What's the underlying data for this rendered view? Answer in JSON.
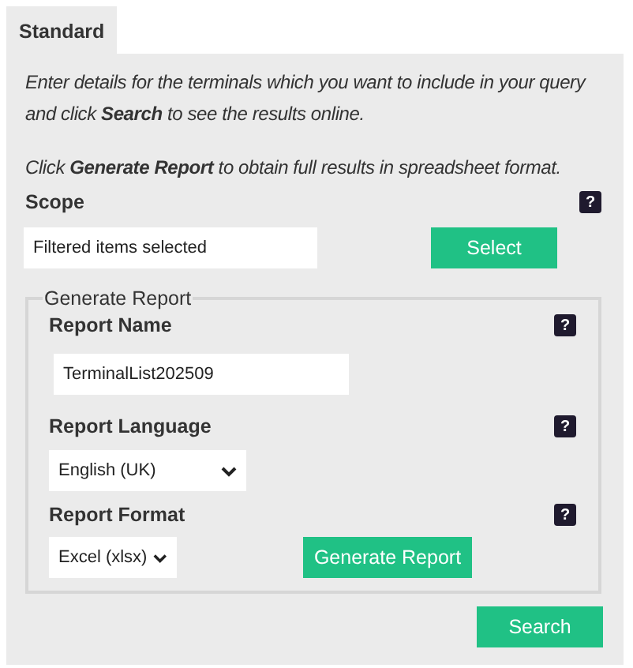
{
  "tabs": [
    {
      "label": "Standard",
      "selected": true
    }
  ],
  "intro": [
    "Enter details for the terminals which you want to include in your query and click **Search** to see the results online.",
    "Click **Generate Report** to obtain full results in spreadsheet format."
  ],
  "scope": {
    "label": "Scope",
    "help": "?",
    "value": "Filtered items selected",
    "button": "Select"
  },
  "generate_report": {
    "legend": "Generate Report",
    "report_name": {
      "label": "Report Name",
      "help": "?",
      "value": "TerminalList202509"
    },
    "report_language": {
      "label": "Report Language",
      "help": "?",
      "value": "English (UK)"
    },
    "report_format": {
      "label": "Report Format",
      "help": "?",
      "value": "Excel (xlsx)"
    },
    "button": "Generate Report"
  },
  "search_button": "Search"
}
